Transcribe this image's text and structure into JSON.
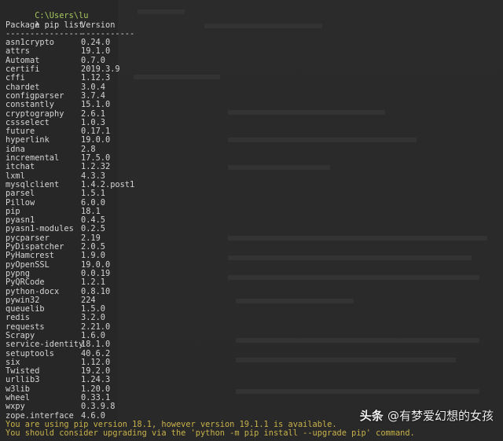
{
  "prompt": {
    "path": "C:\\Users\\lu",
    "symbol": "λ",
    "command": "pip list"
  },
  "table": {
    "header_package": "Package",
    "header_version": "Version",
    "sep_package": "----------------",
    "sep_version": "-----------",
    "rows": [
      {
        "package": "asn1crypto",
        "version": "0.24.0"
      },
      {
        "package": "attrs",
        "version": "19.1.0"
      },
      {
        "package": "Automat",
        "version": "0.7.0"
      },
      {
        "package": "certifi",
        "version": "2019.3.9"
      },
      {
        "package": "cffi",
        "version": "1.12.3"
      },
      {
        "package": "chardet",
        "version": "3.0.4"
      },
      {
        "package": "configparser",
        "version": "3.7.4"
      },
      {
        "package": "constantly",
        "version": "15.1.0"
      },
      {
        "package": "cryptography",
        "version": "2.6.1"
      },
      {
        "package": "cssselect",
        "version": "1.0.3"
      },
      {
        "package": "future",
        "version": "0.17.1"
      },
      {
        "package": "hyperlink",
        "version": "19.0.0"
      },
      {
        "package": "idna",
        "version": "2.8"
      },
      {
        "package": "incremental",
        "version": "17.5.0"
      },
      {
        "package": "itchat",
        "version": "1.2.32"
      },
      {
        "package": "lxml",
        "version": "4.3.3"
      },
      {
        "package": "mysqlclient",
        "version": "1.4.2.post1"
      },
      {
        "package": "parsel",
        "version": "1.5.1"
      },
      {
        "package": "Pillow",
        "version": "6.0.0"
      },
      {
        "package": "pip",
        "version": "18.1"
      },
      {
        "package": "pyasn1",
        "version": "0.4.5"
      },
      {
        "package": "pyasn1-modules",
        "version": "0.2.5"
      },
      {
        "package": "pycparser",
        "version": "2.19"
      },
      {
        "package": "PyDispatcher",
        "version": "2.0.5"
      },
      {
        "package": "PyHamcrest",
        "version": "1.9.0"
      },
      {
        "package": "pyOpenSSL",
        "version": "19.0.0"
      },
      {
        "package": "pypng",
        "version": "0.0.19"
      },
      {
        "package": "PyQRCode",
        "version": "1.2.1"
      },
      {
        "package": "python-docx",
        "version": "0.8.10"
      },
      {
        "package": "pywin32",
        "version": "224"
      },
      {
        "package": "queuelib",
        "version": "1.5.0"
      },
      {
        "package": "redis",
        "version": "3.2.0"
      },
      {
        "package": "requests",
        "version": "2.21.0"
      },
      {
        "package": "Scrapy",
        "version": "1.6.0"
      },
      {
        "package": "service-identity",
        "version": "18.1.0"
      },
      {
        "package": "setuptools",
        "version": "40.6.2"
      },
      {
        "package": "six",
        "version": "1.12.0"
      },
      {
        "package": "Twisted",
        "version": "19.2.0"
      },
      {
        "package": "urllib3",
        "version": "1.24.3"
      },
      {
        "package": "w3lib",
        "version": "1.20.0"
      },
      {
        "package": "wheel",
        "version": "0.33.1"
      },
      {
        "package": "wxpy",
        "version": "0.3.9.8"
      },
      {
        "package": "zope.interface",
        "version": "4.6.0"
      }
    ]
  },
  "warnings": [
    "You are using pip version 18.1, however version 19.1.1 is available.",
    "You should consider upgrading via the 'python -m pip install --upgrade pip' command."
  ],
  "watermark": {
    "brand": "头条",
    "handle": "@有梦爱幻想的女孩"
  },
  "colors": {
    "background": "#272727",
    "path": "#a6c95f",
    "warning": "#c9b24a",
    "text": "#d4d4d4"
  }
}
